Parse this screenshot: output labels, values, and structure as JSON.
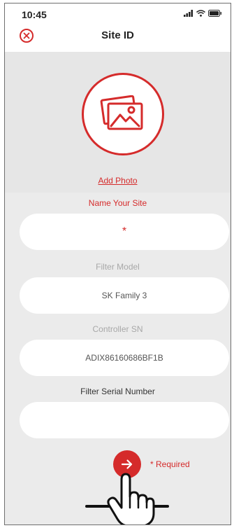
{
  "status_bar": {
    "time": "10:45",
    "signal_icon": "signal-icon",
    "wifi_icon": "wifi-icon",
    "battery_icon": "battery-icon"
  },
  "header": {
    "title": "Site ID",
    "close_icon": "close-icon"
  },
  "photo": {
    "icon": "photo-gallery-icon",
    "add_label": "Add Photo"
  },
  "form": {
    "site_name": {
      "label": "Name Your Site",
      "value": "*"
    },
    "filter_model": {
      "label": "Filter Model",
      "value": "SK Family 3"
    },
    "controller_sn": {
      "label": "Controller SN",
      "value": "ADIX86160686BF1B"
    },
    "filter_serial": {
      "label": "Filter Serial Number",
      "value": ""
    }
  },
  "footer": {
    "next_icon": "arrow-right-icon",
    "required_note": "* Required",
    "pointer_icon": "hand-pointer-icon"
  },
  "colors": {
    "accent": "#d52b2b",
    "panel": "#e6e6e6",
    "background": "#ebebeb",
    "field": "#ffffff"
  }
}
